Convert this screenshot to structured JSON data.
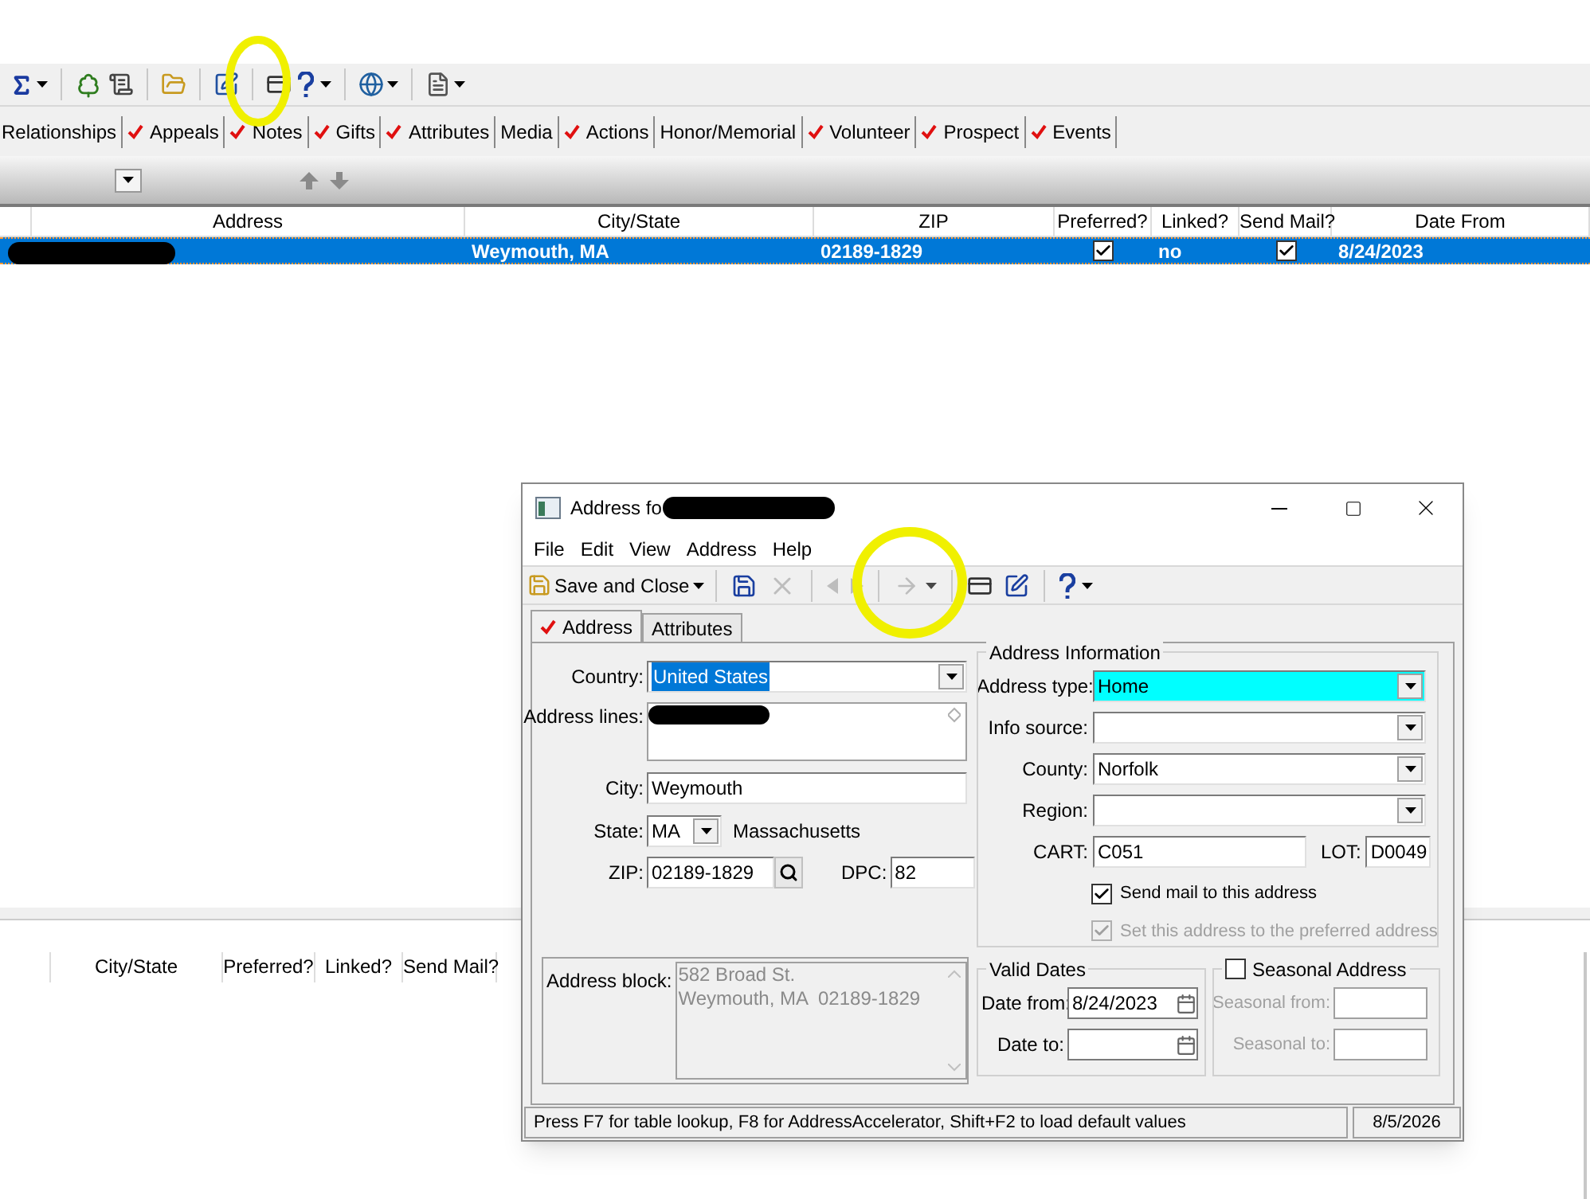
{
  "main_tabs": [
    {
      "label": "Relationships",
      "checked": false
    },
    {
      "label": "Appeals",
      "checked": true
    },
    {
      "label": "Notes",
      "checked": true
    },
    {
      "label": "Gifts",
      "checked": true
    },
    {
      "label": "Attributes",
      "checked": true
    },
    {
      "label": "Media",
      "checked": false
    },
    {
      "label": "Actions",
      "checked": true
    },
    {
      "label": "Honor/Memorial",
      "checked": false
    },
    {
      "label": "Volunteer",
      "checked": true
    },
    {
      "label": "Prospect",
      "checked": true
    },
    {
      "label": "Events",
      "checked": true
    }
  ],
  "grid": {
    "columns": [
      "Address",
      "City/State",
      "ZIP",
      "Preferred?",
      "Linked?",
      "Send Mail?",
      "Date From"
    ],
    "rows": [
      {
        "selected": true,
        "city_state": "Weymouth, MA",
        "zip": "02189-1829",
        "preferred": true,
        "linked": "no",
        "send_mail": true,
        "date_from": "8/24/2023"
      }
    ]
  },
  "lower_grid": {
    "columns": [
      "City/State",
      "Preferred?",
      "Linked?",
      "Send Mail?"
    ]
  },
  "dialog": {
    "title": "Address fo",
    "menu": [
      "File",
      "Edit",
      "View",
      "Address",
      "Help"
    ],
    "toolbar": {
      "save_label": "Save and Close",
      "buttons": [
        {
          "kind": "save",
          "disabled": false
        },
        {
          "kind": "delete",
          "disabled": true
        },
        {
          "kind": "previous",
          "disabled": true
        },
        {
          "kind": "next",
          "disabled": true
        },
        {
          "kind": "goto",
          "disabled": true
        },
        {
          "kind": "card",
          "disabled": false
        },
        {
          "kind": "edit",
          "disabled": false
        },
        {
          "kind": "help",
          "disabled": false
        }
      ]
    },
    "tabs": [
      {
        "label": "Address",
        "checked": true,
        "selected": true
      },
      {
        "label": "Attributes",
        "checked": false,
        "selected": false
      }
    ],
    "country": {
      "label": "Country:",
      "value": "United States"
    },
    "address_lines": {
      "label": "Address lines:"
    },
    "city": {
      "label": "City:",
      "value": "Weymouth"
    },
    "state": {
      "label": "State:",
      "value": "MA",
      "name": "Massachusetts"
    },
    "zip": {
      "label": "ZIP:",
      "value": "02189-1829"
    },
    "dpc": {
      "label": "DPC:",
      "value": "82"
    },
    "address_block": {
      "label": "Address block:",
      "lines": [
        "582 Broad St.",
        "Weymouth, MA  02189-1829"
      ]
    },
    "address_info": {
      "title": "Address Information",
      "dropdowns": [
        {
          "label": "Address type:",
          "value": "Home",
          "highlighted": true
        },
        {
          "label": "Info source:",
          "highlighted": false
        },
        {
          "label": "County:",
          "value": "Norfolk",
          "highlighted": false
        },
        {
          "label": "Region:",
          "highlighted": false
        }
      ],
      "cart": {
        "label": "CART:",
        "value": "C051"
      },
      "lot": {
        "label": "LOT:",
        "value": "D0049"
      },
      "checkboxes": [
        {
          "label": "Send mail to this address",
          "checked": true,
          "disabled": false
        },
        {
          "label": "Set this address to the preferred address",
          "checked": true,
          "disabled": true
        }
      ]
    },
    "valid_dates": {
      "title": "Valid Dates",
      "from": {
        "label": "Date from:",
        "value": "8/24/2023"
      },
      "to": {
        "label": "Date to:"
      }
    },
    "seasonal": {
      "title": "Seasonal Address",
      "checked": false,
      "disabled": true,
      "from": {
        "label": "Seasonal from:"
      },
      "to": {
        "label": "Seasonal to:"
      }
    },
    "status": {
      "message": "Press F7 for table lookup, F8 for AddressAccelerator, Shift+F2 to load default values",
      "date": "8/5/2026"
    }
  }
}
